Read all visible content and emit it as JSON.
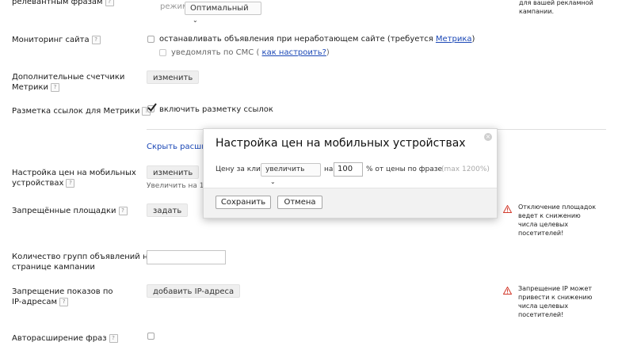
{
  "rows": {
    "phrases_label": "релевантным фразам",
    "mode_label": "режим",
    "mode_value": "Оптимальный",
    "monitoring_label": "Мониторинг сайта",
    "monitoring_option_prefix": "останавливать объявления при неработающем сайте (требуется ",
    "monitoring_option_link": "Метрика",
    "monitoring_option_suffix": ")",
    "sms_prefix": "уведомлять по СМС ( ",
    "sms_link": "как настроить?",
    "sms_suffix": ")",
    "counters_label_1": "Дополнительные счетчики",
    "counters_label_2": "Метрики",
    "counters_button": "изменить",
    "markup_label": "Разметка ссылок для Метрики",
    "markup_option": "включить разметку ссылок",
    "hide_link": "Скрыть расшире",
    "mobile_label_1": "Настройка цен на мобильных",
    "mobile_label_2": "устройствах",
    "mobile_button": "изменить",
    "mobile_hint": "Увеличить на 1",
    "forbidden_label": "Запрещённые площадки",
    "forbidden_button": "задать",
    "groups_label_1": "Количество групп объявлений на",
    "groups_label_2": "странице кампании",
    "ip_label_1": "Запрещение показов по",
    "ip_label_2": "IP-адресам",
    "ip_button": "добавить IP-адреса",
    "autoexp_label": "Авторасширение фраз"
  },
  "right_col": {
    "top_text_1": "для вашей рекламной",
    "top_text_2": "кампании.",
    "warn1": [
      "Отключение площадок",
      "ведет к снижению",
      "числа целевых",
      "посетителей!"
    ],
    "warn2": [
      "Запрещение IP может",
      "привести к снижению",
      "числа целевых",
      "посетителей!"
    ]
  },
  "popup": {
    "title": "Настройка цен на мобильных устройствах",
    "price_label": "Цену за клик",
    "action_value": "увеличить",
    "on_label": "на",
    "percent_value": "100",
    "percent_suffix": "% от цены по фразе",
    "max_hint": "(max 1200%)",
    "save_button": "Сохранить",
    "cancel_button": "Отмена"
  },
  "colors": {
    "link": "#1a47b6",
    "warning": "#d33a2c",
    "checkmark": "#222222"
  }
}
